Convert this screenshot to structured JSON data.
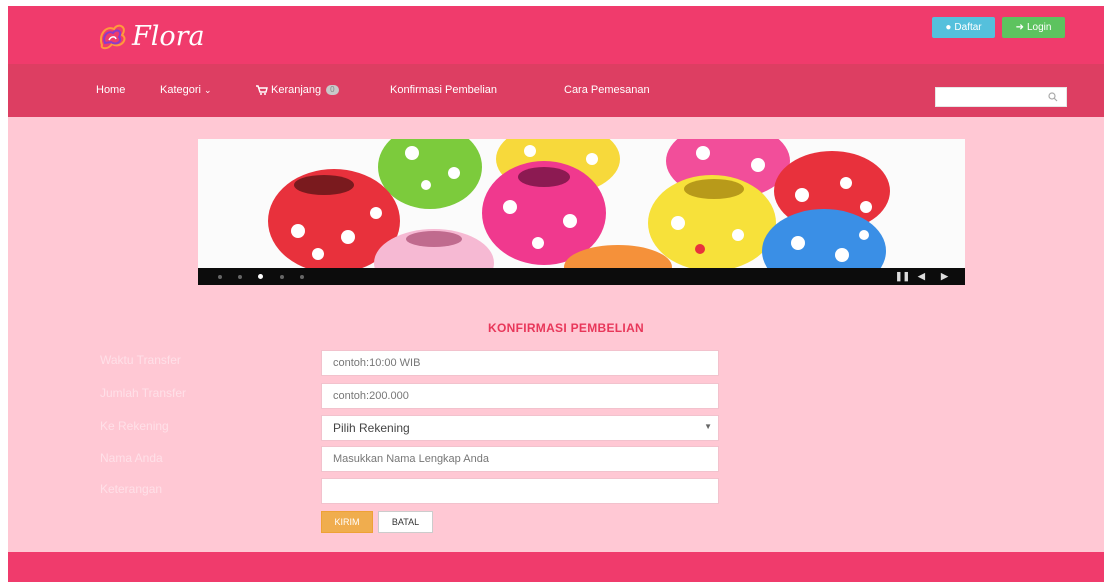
{
  "brand": {
    "name": "Flora"
  },
  "top_buttons": {
    "daftar_label": "Daftar",
    "login_label": "Login"
  },
  "nav": {
    "items": [
      {
        "label": "Home"
      },
      {
        "label": "Kategori"
      },
      {
        "label": "Keranjang",
        "badge": "0"
      },
      {
        "label": "Konfirmasi Pembelian"
      },
      {
        "label": "Cara Pemesanan"
      }
    ],
    "search_placeholder": ""
  },
  "slider": {
    "slide_count": 5,
    "active_slide": 3
  },
  "form": {
    "title": "KONFIRMASI PEMBELIAN",
    "fields": [
      {
        "label": "Waktu Transfer",
        "placeholder": "contoh:10:00 WIB"
      },
      {
        "label": "Jumlah Transfer",
        "placeholder": "contoh:200.000"
      },
      {
        "label": "Ke Rekening",
        "selected": "Pilih Rekening"
      },
      {
        "label": "Nama Anda",
        "placeholder": "Masukkan Nama Lengkap Anda"
      },
      {
        "label": "Keterangan",
        "placeholder": ""
      }
    ],
    "submit_label": "KIRIM",
    "cancel_label": "BATAL"
  },
  "colors": {
    "primary": "#f03b6c",
    "nav": "#dd3e62",
    "background": "#ffc8d4",
    "accent_button": "#f0ad4e"
  }
}
